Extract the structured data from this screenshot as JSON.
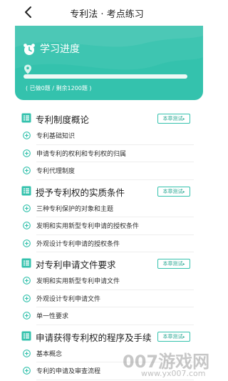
{
  "header": {
    "title": "专利法 · 考点练习",
    "back_icon": "back-chevron-icon"
  },
  "progress": {
    "title": "学习进度",
    "icon": "alarm-clock-icon",
    "stats": "( 已做0题 / 剩余1200题 )",
    "done": 0,
    "remaining": 1200,
    "fraction": 0.0,
    "card_color": "#34c2ad"
  },
  "chapters": [
    {
      "title": "专利制度概论",
      "test_label": "本章测试",
      "items": [
        "专利基础知识",
        "申请专利的权利和专利权的归属",
        "专利代理制度"
      ]
    },
    {
      "title": "授予专利权的实质条件",
      "test_label": "本章测试",
      "items": [
        "三种专利保护的对象和主题",
        "发明和实用新型专利申请的授权条件",
        "外观设计专利申请的授权条件"
      ]
    },
    {
      "title": "对专利申请文件要求",
      "test_label": "本章测试",
      "items": [
        "发明和实用新型专利申请文件",
        "外观设计专利申请文件",
        "单一性要求"
      ]
    },
    {
      "title": "申请获得专利权的程序及手续",
      "test_label": "本章测试",
      "items": [
        "基本概念",
        "专利的申请及审查流程"
      ]
    }
  ],
  "watermark": {
    "text": "007游戏网",
    "url": "www.yx007.com"
  }
}
